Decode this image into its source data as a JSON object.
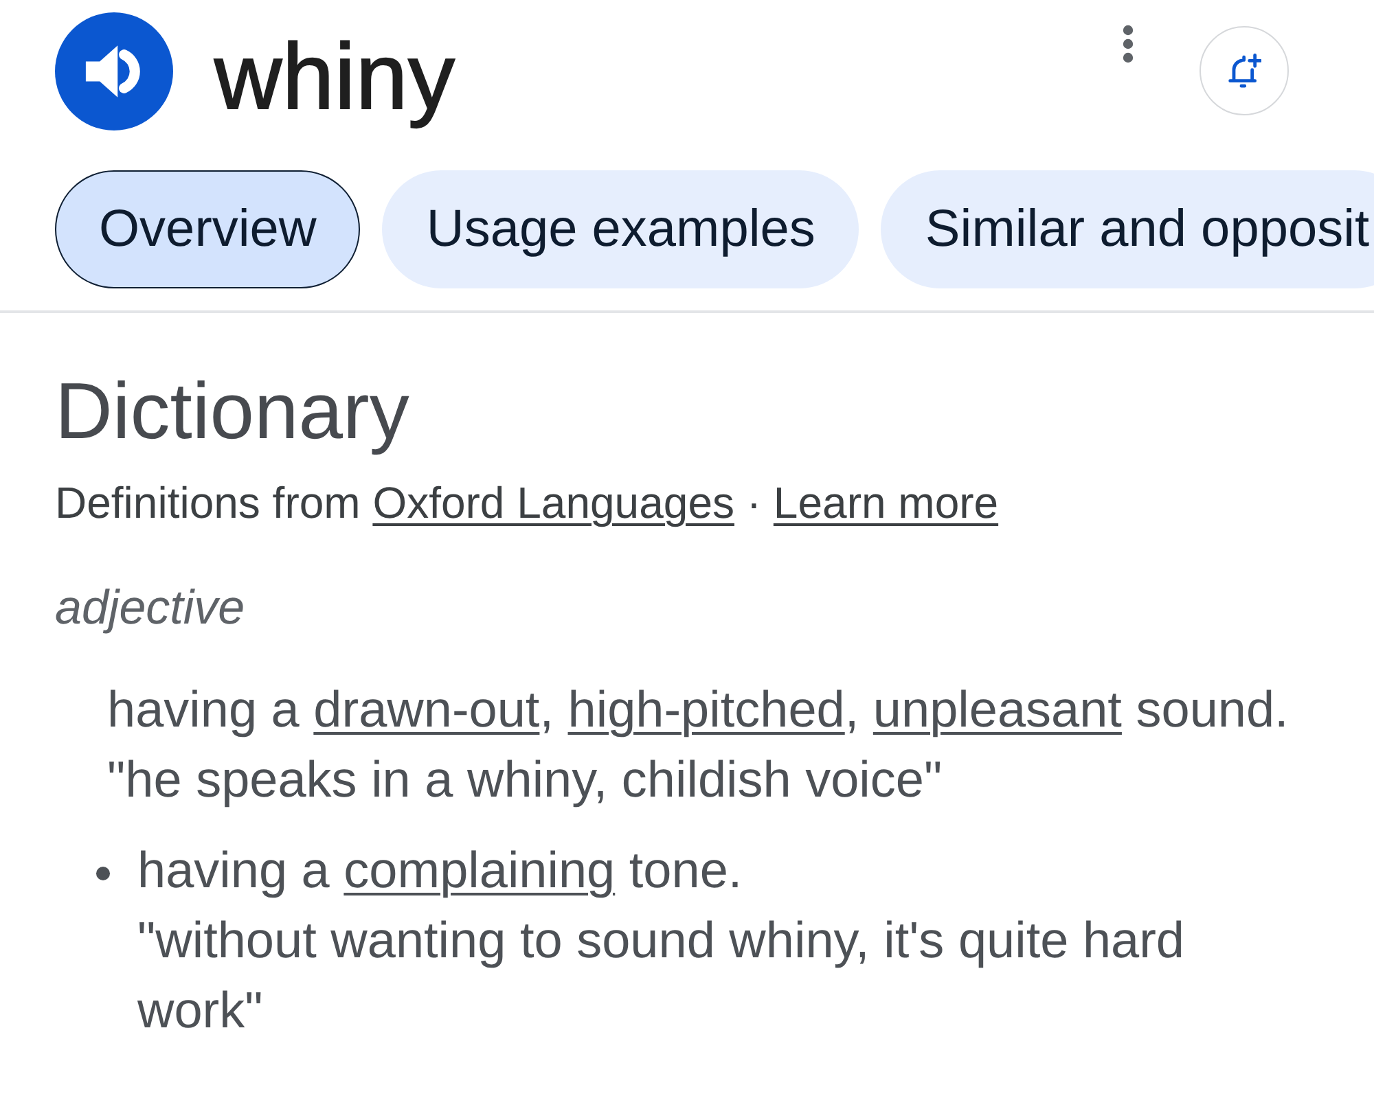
{
  "header": {
    "word": "whiny"
  },
  "tabs": [
    {
      "label": "Overview",
      "selected": true
    },
    {
      "label": "Usage examples",
      "selected": false
    },
    {
      "label": "Similar and opposit",
      "selected": false
    }
  ],
  "dictionary": {
    "title": "Dictionary",
    "source": [
      {
        "text": "Definitions from ",
        "link": "Oxford Languages"
      },
      {
        "text": " · ",
        "link": "Learn more"
      }
    ],
    "part_of_speech": "adjective",
    "senses": [
      {
        "bullet": false,
        "definition": [
          {
            "text": "having a ",
            "link": "drawn-out"
          },
          {
            "text": ", ",
            "link": "high-pitched"
          },
          {
            "text": ", ",
            "link": "unpleasant"
          },
          {
            "text": " sound."
          }
        ],
        "example": "\"he speaks in a whiny, childish voice\""
      },
      {
        "bullet": true,
        "definition": [
          {
            "text": "having a ",
            "link": "complaining"
          },
          {
            "text": " tone."
          }
        ],
        "example": "\"without wanting to sound whiny, it's quite hard work\""
      }
    ]
  }
}
